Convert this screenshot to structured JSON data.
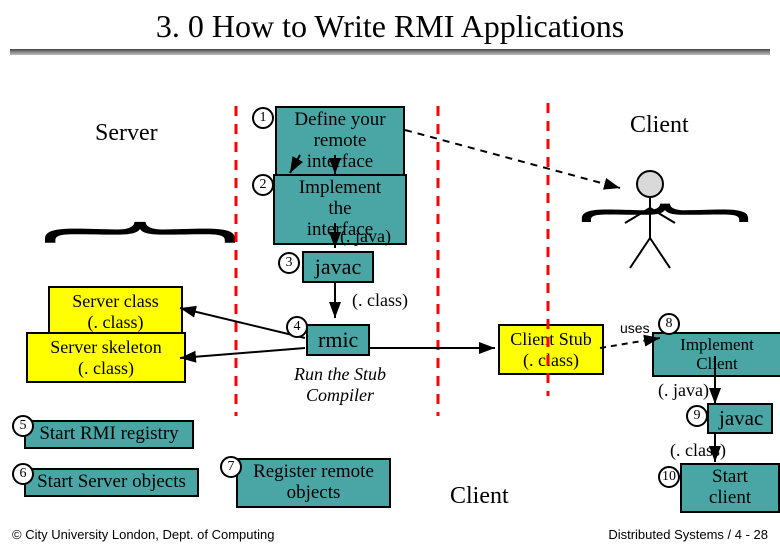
{
  "title": "3. 0 How to Write RMI Applications",
  "server_label": "Server",
  "client_label": "Client",
  "steps": {
    "s1": "Define your\nremote interface",
    "s2": "Implement the\ninterface",
    "s3": "javac",
    "s4": "rmic",
    "s5": "Start RMI registry",
    "s6": "Start Server objects",
    "s7": "Register remote\nobjects",
    "s8": "Implement Client",
    "s9": "javac",
    "s10": "Start client"
  },
  "numbers": {
    "n1": "1",
    "n2": "2",
    "n3": "3",
    "n4": "4",
    "n5": "5",
    "n6": "6",
    "n7": "7",
    "n8": "8",
    "n9": "9",
    "n10": "10"
  },
  "labels": {
    "java_ext": "(. java)",
    "class_ext": "(. class)",
    "run_stub": "Run the Stub\nCompiler",
    "server_class": "Server class\n(. class)",
    "server_skeleton": "Server skeleton\n(. class)",
    "client_stub": "Client Stub\n(. class)",
    "client_bottom": "Client",
    "uses": "uses"
  },
  "footer": {
    "left": "© City University London, Dept. of Computing",
    "right": "Distributed Systems / 4 - 28"
  },
  "colors": {
    "teal": "#4aa5a5",
    "yellow": "#ffff00"
  }
}
